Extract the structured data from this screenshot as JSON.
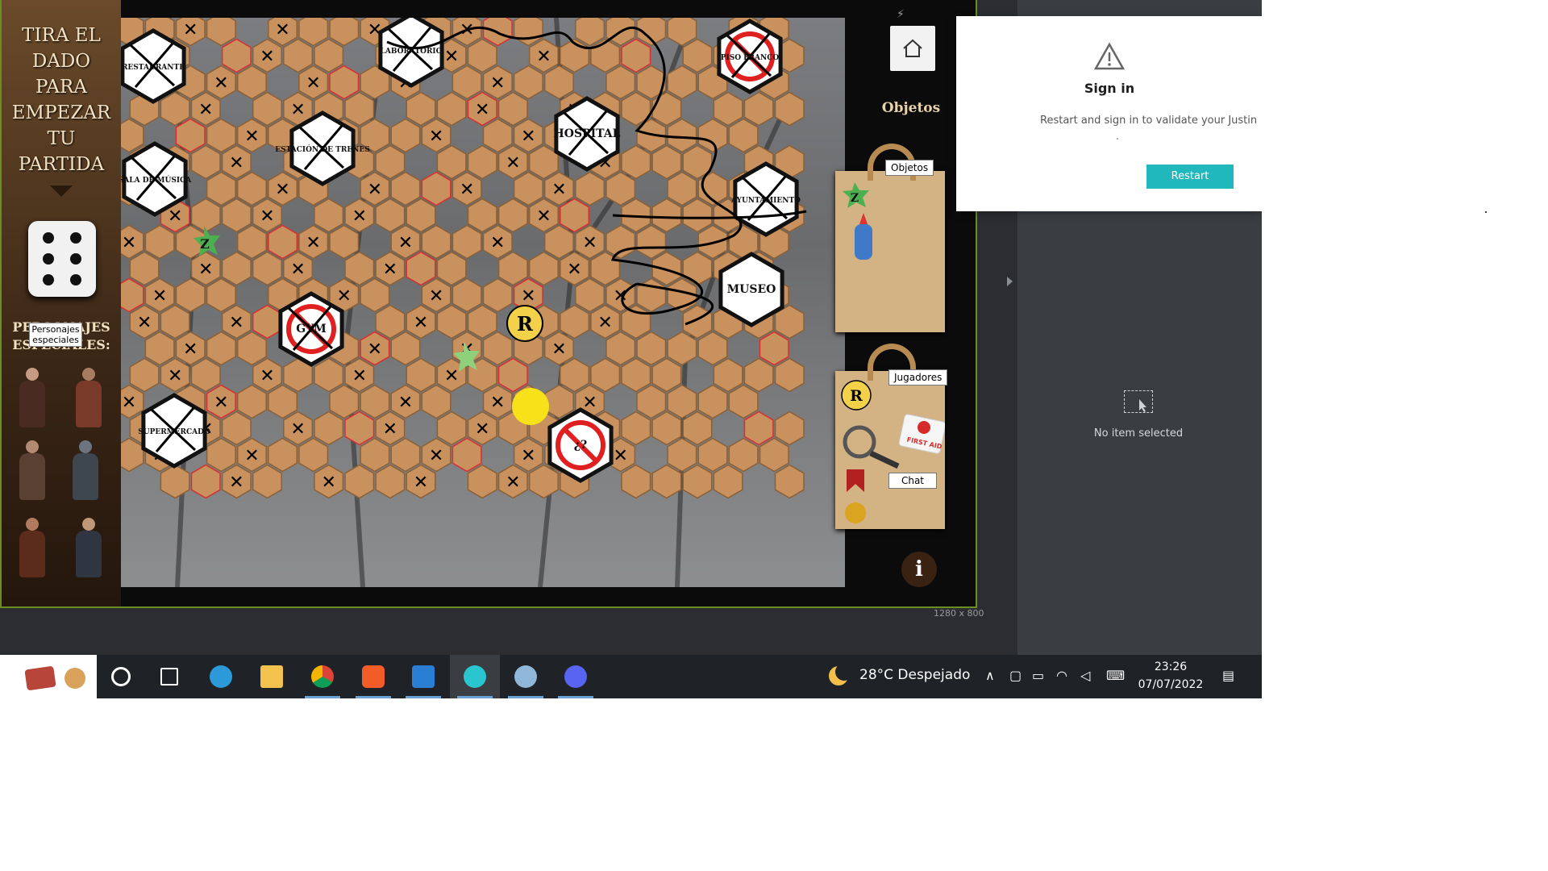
{
  "game": {
    "dice_title": [
      "TIRA EL",
      "DADO",
      "PARA",
      "EMPEZAR",
      "TU",
      "PARTIDA"
    ],
    "characters_title": "PERSONAJES ESPECIALES:",
    "characters_tooltip": "Personajes especiales",
    "dice_value": 6,
    "rooms": [
      {
        "label": "RESTAURANTE",
        "crossed": true
      },
      {
        "label": "LABORATORIO",
        "crossed": true
      },
      {
        "label": "PISO FRANCO",
        "crossed": true,
        "forbidden": true
      },
      {
        "label": "SALA DE MÚSICA",
        "crossed": true
      },
      {
        "label": "ESTACIÓN DE TRENES",
        "crossed": true
      },
      {
        "label": "HOSPITAL",
        "crossed": true
      },
      {
        "label": "AYUNTAMIENTO",
        "crossed": true
      },
      {
        "label": "MUSEO",
        "crossed": false
      },
      {
        "label": "GYM",
        "crossed": true,
        "forbidden": true
      },
      {
        "label": "SUPERMERCADO",
        "crossed": true
      },
      {
        "label": "¿?",
        "crossed": false,
        "forbidden": true
      }
    ],
    "tokens": {
      "r_label": "R",
      "z_label": "Z"
    },
    "objects_heading": "Objetos",
    "objects_tag": "Objetos",
    "players_tag": "Jugadores",
    "chat_tag": "Chat",
    "first_aid_label": "FIRST AID",
    "info_label": "i",
    "canvas_size": "1280 x 800"
  },
  "editor": {
    "no_item_text": "No item selected"
  },
  "signin": {
    "title": "Sign in",
    "message": "Restart and sign in to validate your Justin",
    "dot": ".",
    "button": "Restart"
  },
  "taskbar": {
    "weather": "28°C  Despejado",
    "time": "23:26",
    "date": "07/07/2022",
    "apps": [
      "search",
      "task-view",
      "edge",
      "file-explorer",
      "chrome",
      "brave",
      "vscode",
      "active-app",
      "paint",
      "discord"
    ]
  },
  "colors": {
    "accent_teal": "#20b8bc",
    "stage_border": "#6b8e23",
    "hex_fill": "#c8915d",
    "token_yellow": "#f7e21a"
  }
}
